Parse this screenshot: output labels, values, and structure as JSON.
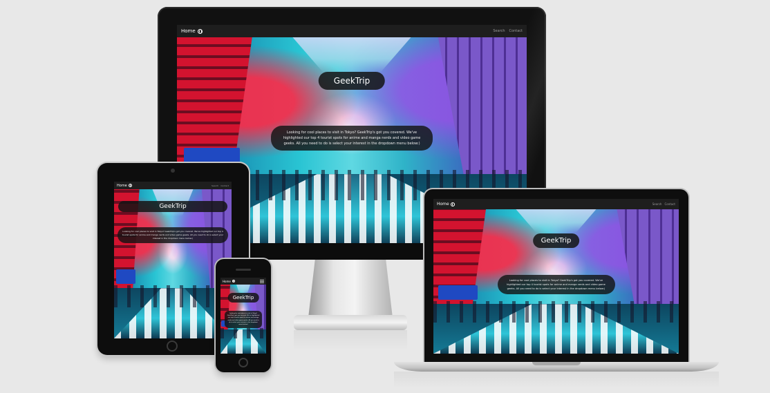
{
  "site": {
    "brand": "Home",
    "brand_icon": "globe-icon",
    "nav_links": [
      "Search",
      "Contact"
    ],
    "title": "GeekTrip",
    "description": "Looking for cool places to visit in Tokyo? GeekTrip's got you covered. We've highlighted our top 4 tourist spots for anime and manga nerds and video game geeks. All you need to do is select your interest in the dropdown menu below:)"
  },
  "devices": [
    "desktop-monitor",
    "tablet",
    "phone",
    "laptop"
  ]
}
